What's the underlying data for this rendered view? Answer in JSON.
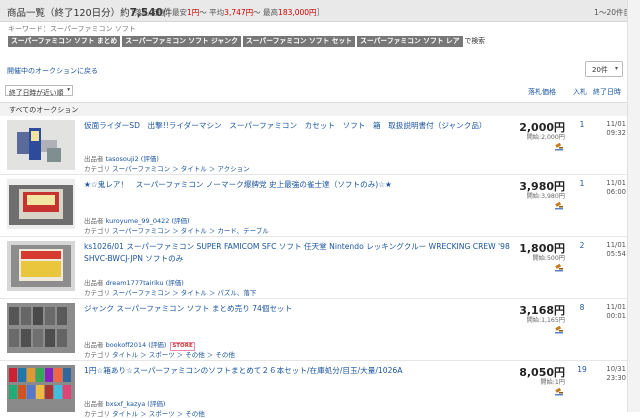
{
  "header": {
    "title_prefix": "商品一覧（終了120日分）約",
    "count": "7,540",
    "count_suffix": "件",
    "stats_open": "［落札価格：最安",
    "min": "1円",
    "avg_label": "～ 平均",
    "avg": "3,747円",
    "max_label": "～ 最高",
    "max": "183,000円",
    "stats_close": "］",
    "range": "1～20件目"
  },
  "keyword": "キーワード：スーパーファミコン ソフト",
  "related_tags": [
    "スーパーファミコン ソフト まとめ",
    "スーパーファミコン ソフト ジャンク",
    "スーパーファミコン ソフト セット",
    "スーパーファミコン ソフト レア"
  ],
  "related_suffix": "で検索",
  "hold_link": "開催中のオークションに戻る",
  "per_page": "20件",
  "sort": "終了日時が近い順",
  "columns": {
    "price": "落札価格",
    "bids": "入札",
    "end": "終了日時"
  },
  "category_bar": "すべてのオークション",
  "items": [
    {
      "title": "仮面ライダーSD　出撃!!ライダーマシン　スーパーファミコン　カセット　ソフト　箱　取扱説明書付（ジャンク品）",
      "seller_label": "出品者",
      "seller": "tasosouji2",
      "rating": "(評価)",
      "cat_label": "カテゴリ",
      "cat_path": "スーパーファミコン ＞ タイトル ＞ アクション",
      "price": "2,000円",
      "start": "開始:2,000円",
      "bids": "1",
      "date": "11/01",
      "time": "09:32"
    },
    {
      "title": "★☆鬼レア！　スーパーファミコン ノーマーク爆牌党 史上最強の雀士達（ソフトのみ)☆★",
      "seller_label": "出品者",
      "seller": "kuroyume_99_0422",
      "rating": "(評価)",
      "cat_label": "カテゴリ",
      "cat_path": "スーパーファミコン ＞ タイトル ＞ カード、テーブル",
      "price": "3,980円",
      "start": "開始:3,980円",
      "bids": "1",
      "date": "11/01",
      "time": "06:00"
    },
    {
      "title": "ks1026/01 スーパーファミコン SUPER FAMICOM SFC ソフト 任天堂 Nintendo レッキングクルー WRECKING CREW '98 SHVC-BWCJ-JPN ソフトのみ",
      "seller_label": "出品者",
      "seller": "dream1777tairiku",
      "rating": "(評価)",
      "cat_label": "カテゴリ",
      "cat_path": "スーパーファミコン ＞ タイトル ＞ パズル、落下",
      "price": "1,800円",
      "start": "開始:500円",
      "bids": "2",
      "date": "11/01",
      "time": "05:54"
    },
    {
      "title": "ジャンク スーパーファミコン ソフト まとめ売り 74個セット",
      "seller_label": "出品者",
      "seller": "bookoff2014",
      "rating": "(評価)",
      "store": "STORE",
      "cat_label": "カテゴリ",
      "cat_path": "タイトル ＞ スポーツ ＞ その他 ＞ その他",
      "price": "3,168円",
      "start": "開始:1,165円",
      "bids": "8",
      "date": "11/01",
      "time": "00:01"
    },
    {
      "title": "1円☆箱あり☆スーパーファミコンのソフトまとめて２６本セット/在庫処分/目玉/大量/1026A",
      "seller_label": "出品者",
      "seller": "bxsxf_kazya",
      "rating": "(評価)",
      "cat_label": "カテゴリ",
      "cat_path": "タイトル ＞ スポーツ ＞ その他",
      "price": "8,050円",
      "start": "開始:1円",
      "bids": "19",
      "date": "10/31",
      "time": "23:30"
    }
  ],
  "colors": {
    "link": "#1a55a0",
    "header_bg": "#e9e9e9",
    "tag_bg": "#777777",
    "stat_red": "#cc0000"
  }
}
